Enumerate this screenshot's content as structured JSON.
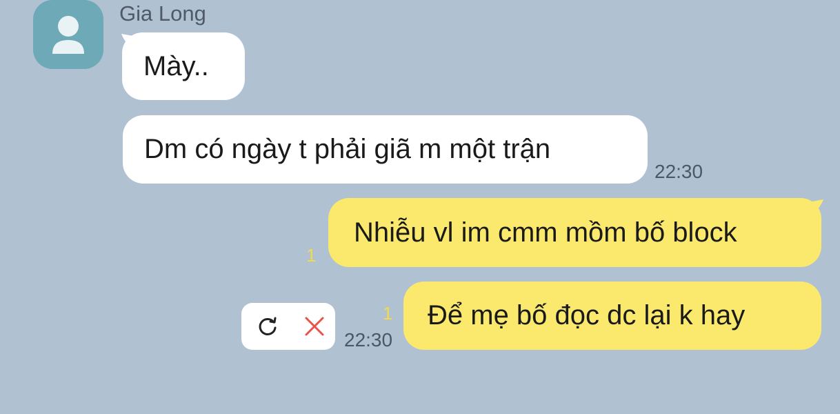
{
  "sender": {
    "name": "Gia Long"
  },
  "messages": [
    {
      "text": "Mày..",
      "direction": "incoming"
    },
    {
      "text": "Dm có ngày t phải giã m một trận",
      "direction": "incoming",
      "time": "22:30"
    },
    {
      "text": "Nhiễu vl im cmm mồm bố block",
      "direction": "outgoing",
      "read_count": "1"
    },
    {
      "text": "Để mẹ bố đọc dc lại k hay",
      "direction": "outgoing",
      "read_count": "1",
      "time": "22:30",
      "status": "failed"
    }
  ],
  "failed_actions": {
    "retry_icon": "refresh-icon",
    "delete_icon": "close-icon"
  },
  "colors": {
    "background": "#b0c2d2",
    "incoming_bubble": "#ffffff",
    "outgoing_bubble": "#fbe96d",
    "avatar": "#6ea9b7",
    "read_count": "#f4da4a",
    "delete": "#e5534b"
  }
}
